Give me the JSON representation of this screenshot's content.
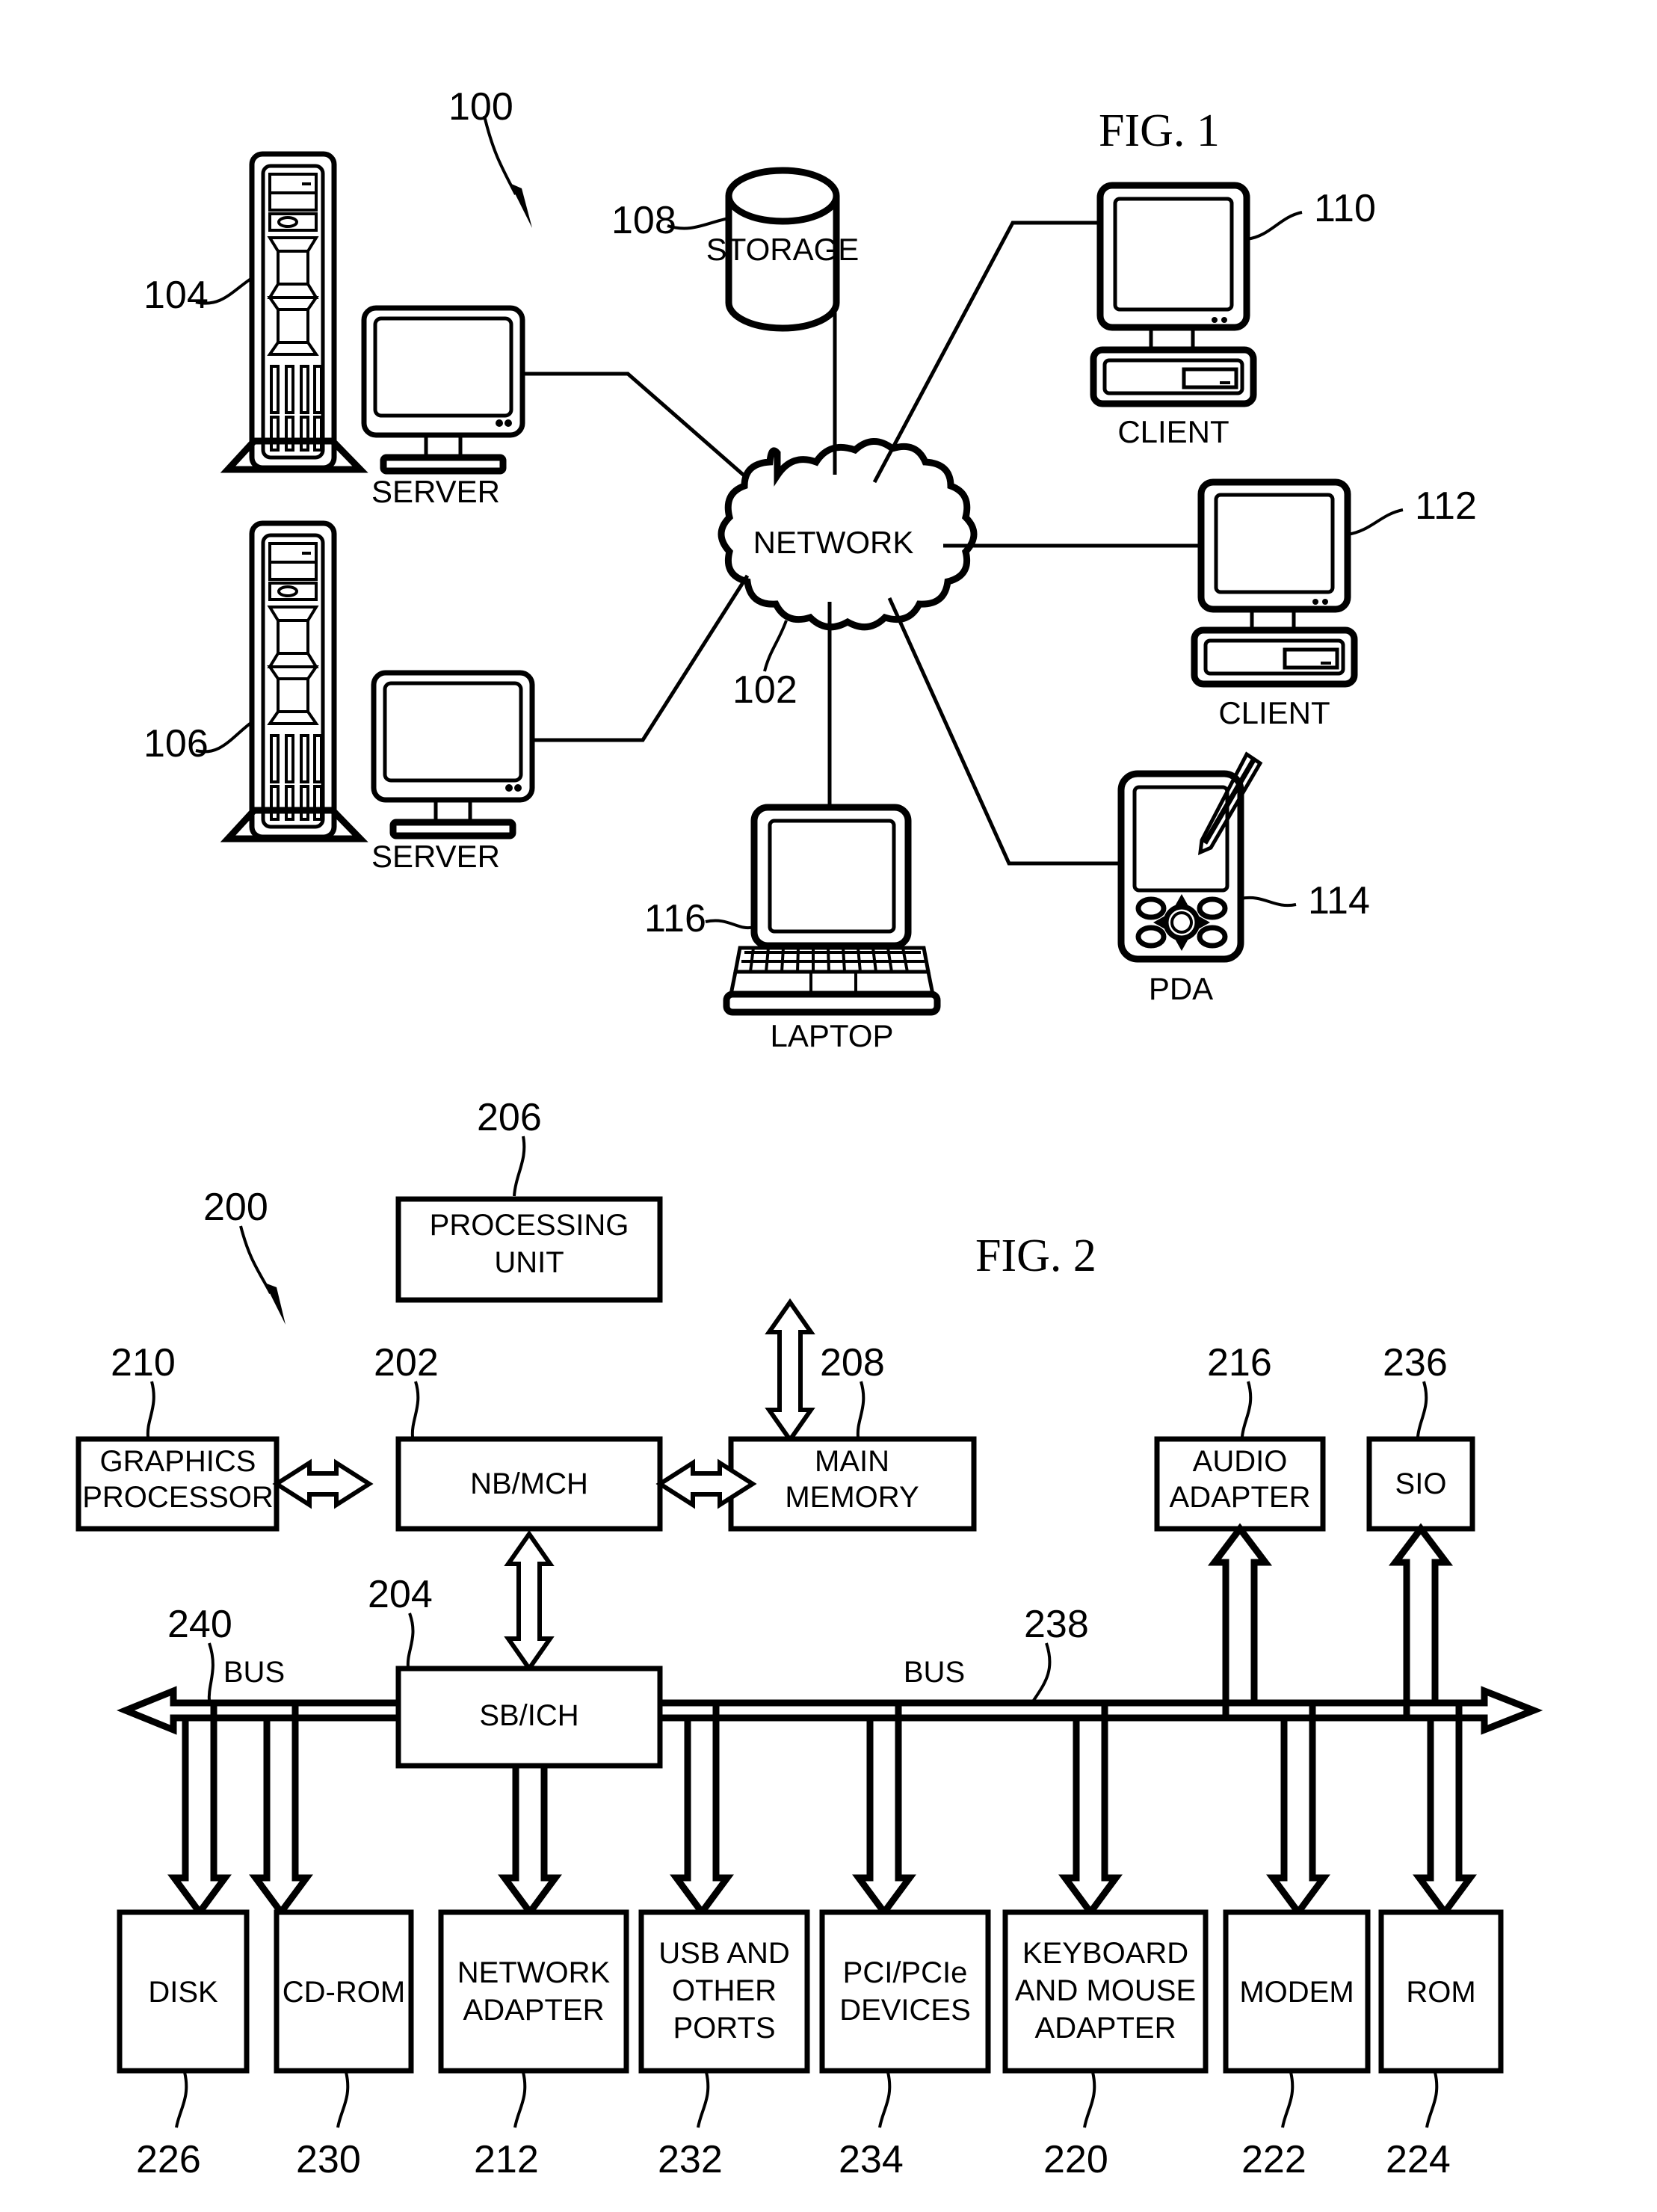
{
  "figures": [
    {
      "id": "fig1",
      "title": "FIG. 1",
      "system_ref": "100",
      "nodes": [
        {
          "ref": "104",
          "label": "SERVER",
          "kind": "server-tower-with-monitor"
        },
        {
          "ref": "106",
          "label": "SERVER",
          "kind": "server-tower-with-monitor"
        },
        {
          "ref": "108",
          "label": "STORAGE",
          "kind": "storage-cylinder"
        },
        {
          "ref": "102",
          "label": "NETWORK",
          "kind": "network-cloud"
        },
        {
          "ref": "110",
          "label": "CLIENT",
          "kind": "desktop-computer"
        },
        {
          "ref": "112",
          "label": "CLIENT",
          "kind": "desktop-computer"
        },
        {
          "ref": "114",
          "label": "PDA",
          "kind": "pda-with-stylus"
        },
        {
          "ref": "116",
          "label": "LAPTOP",
          "kind": "laptop"
        }
      ]
    },
    {
      "id": "fig2",
      "title": "FIG. 2",
      "system_ref": "200",
      "top": [
        {
          "ref": "206",
          "label_line1": "PROCESSING",
          "label_line2": "UNIT"
        }
      ],
      "middle": [
        {
          "ref": "210",
          "label_line1": "GRAPHICS",
          "label_line2": "PROCESSOR"
        },
        {
          "ref": "202",
          "label_line1": "NB/MCH",
          "label_line2": ""
        },
        {
          "ref": "208",
          "label_line1": "MAIN",
          "label_line2": "MEMORY"
        },
        {
          "ref": "216",
          "label_line1": "AUDIO",
          "label_line2": "ADAPTER"
        },
        {
          "ref": "236",
          "label_line1": "SIO",
          "label_line2": ""
        }
      ],
      "hub": {
        "ref": "204",
        "label": "SB/ICH"
      },
      "buses": [
        {
          "ref": "240",
          "label": "BUS"
        },
        {
          "ref": "238",
          "label": "BUS"
        }
      ],
      "bottom": [
        {
          "ref": "226",
          "lines": [
            "DISK"
          ]
        },
        {
          "ref": "230",
          "lines": [
            "CD-ROM"
          ]
        },
        {
          "ref": "212",
          "lines": [
            "NETWORK",
            "ADAPTER"
          ]
        },
        {
          "ref": "232",
          "lines": [
            "USB AND",
            "OTHER",
            "PORTS"
          ]
        },
        {
          "ref": "234",
          "lines": [
            "PCI/PCIe",
            "DEVICES"
          ]
        },
        {
          "ref": "220",
          "lines": [
            "KEYBOARD",
            "AND MOUSE",
            "ADAPTER"
          ]
        },
        {
          "ref": "222",
          "lines": [
            "MODEM"
          ]
        },
        {
          "ref": "224",
          "lines": [
            "ROM"
          ]
        }
      ]
    }
  ],
  "colors": {
    "ink": "#000000",
    "paper": "#ffffff"
  }
}
